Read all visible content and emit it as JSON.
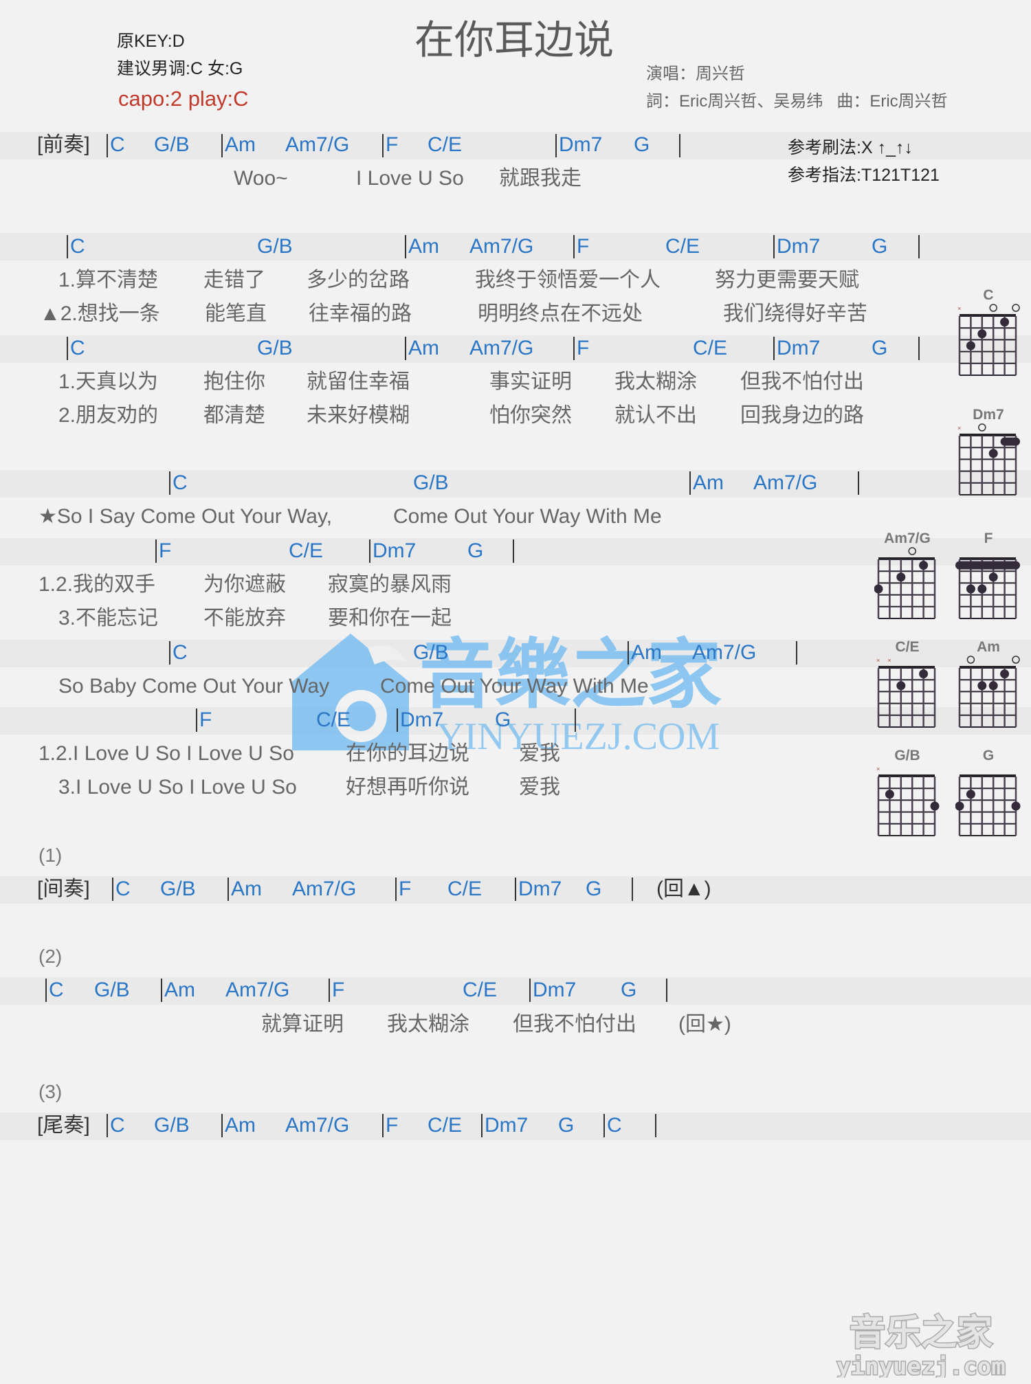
{
  "header": {
    "title": "在你耳边说",
    "original_key": "原KEY:D",
    "suggested_key": "建议男调:C 女:G",
    "capo": "capo:2 play:C",
    "singer": "演唱：周兴哲",
    "credits": "詞：Eric周兴哲、吴易纬   曲：Eric周兴哲",
    "strum": "参考刷法:X ↑_↑↓",
    "finger": "参考指法:T121T121"
  },
  "sections": {
    "prelude": {
      "label": "[前奏]",
      "chords": [
        "C",
        "G/B",
        "Am",
        "Am7/G",
        "F",
        "C/E",
        "Dm7",
        "G"
      ],
      "lyrics": [
        "Woo~",
        "I Love U So",
        "就跟我走"
      ]
    },
    "verse1": {
      "chords": [
        "C",
        "G/B",
        "Am",
        "Am7/G",
        "F",
        "C/E",
        "Dm7",
        "G"
      ],
      "line1": [
        "1.算不清楚",
        "走错了",
        "多少的岔路",
        "我终于领悟爱一个人",
        "努力更需要天赋"
      ],
      "line2": [
        "▲2.想找一条",
        "能笔直",
        "往幸福的路",
        "明明终点在不远处",
        "我们绕得好辛苦"
      ]
    },
    "verse2": {
      "chords": [
        "C",
        "G/B",
        "Am",
        "Am7/G",
        "F",
        "C/E",
        "Dm7",
        "G"
      ],
      "line1": [
        "1.天真以为",
        "抱住你",
        "就留住幸福",
        "事实证明",
        "我太糊涂",
        "但我不怕付出"
      ],
      "line2": [
        "2.朋友劝的",
        "都清楚",
        "未来好模糊",
        "怕你突然",
        "就认不出",
        "回我身边的路"
      ]
    },
    "chorus1": {
      "chords": [
        "C",
        "G/B",
        "Am",
        "Am7/G"
      ],
      "lyric": [
        "★So I Say Come Out Your Way,",
        "Come Out Your Way With Me"
      ]
    },
    "chorus2": {
      "chords": [
        "F",
        "C/E",
        "Dm7",
        "G"
      ],
      "line1": [
        "1.2.我的双手",
        "为你遮蔽",
        "寂寞的暴风雨"
      ],
      "line2": [
        "3.不能忘记",
        "不能放弃",
        "要和你在一起"
      ]
    },
    "chorus3": {
      "chords": [
        "C",
        "G/B",
        "Am",
        "Am7/G"
      ],
      "lyric": [
        "So Baby Come Out Your Way",
        "Come Out Your Way With Me"
      ]
    },
    "chorus4": {
      "chords": [
        "F",
        "C/E",
        "Dm7",
        "G"
      ],
      "line1": [
        "1.2.I Love U So I Love U So",
        "在你的耳边说",
        "爱我"
      ],
      "line2": [
        "3.I Love U So I Love U So",
        "好想再听你说",
        "爱我"
      ]
    },
    "interlude": {
      "number": "(1)",
      "label": "[间奏]",
      "chords": [
        "C",
        "G/B",
        "Am",
        "Am7/G",
        "F",
        "C/E",
        "Dm7",
        "G"
      ],
      "repeat": "(回▲)"
    },
    "bridge": {
      "number": "(2)",
      "chords": [
        "C",
        "G/B",
        "Am",
        "Am7/G",
        "F",
        "C/E",
        "Dm7",
        "G"
      ],
      "lyrics": [
        "就算证明",
        "我太糊涂",
        "但我不怕付出",
        "(回★)"
      ]
    },
    "outro": {
      "number": "(3)",
      "label": "[尾奏]",
      "chords": [
        "C",
        "G/B",
        "Am",
        "Am7/G",
        "F",
        "C/E",
        "Dm7",
        "G",
        "C"
      ]
    }
  },
  "chord_diagrams": [
    {
      "name": "C",
      "muted": [
        6
      ],
      "open": [
        3,
        1
      ],
      "dots": [
        [
          2,
          1
        ],
        [
          4,
          2
        ],
        [
          5,
          3
        ]
      ],
      "barre": null
    },
    {
      "name": "Dm7",
      "muted": [
        6
      ],
      "open": [
        4
      ],
      "dots": [
        [
          3,
          2
        ]
      ],
      "barre": {
        "fret": 1,
        "from": 2,
        "to": 1
      }
    },
    {
      "name": "Am7/G",
      "muted": [],
      "open": [
        3
      ],
      "dots": [
        [
          2,
          1
        ],
        [
          4,
          2
        ],
        [
          6,
          3
        ]
      ],
      "barre": null
    },
    {
      "name": "F",
      "muted": [],
      "open": [],
      "dots": [
        [
          3,
          2
        ],
        [
          5,
          3
        ],
        [
          4,
          3
        ]
      ],
      "barre": {
        "fret": 1,
        "from": 6,
        "to": 1
      }
    },
    {
      "name": "C/E",
      "muted": [
        6,
        5
      ],
      "open": [],
      "dots": [
        [
          2,
          1
        ],
        [
          4,
          2
        ]
      ],
      "barre": null
    },
    {
      "name": "Am",
      "muted": [],
      "open": [
        5,
        1
      ],
      "dots": [
        [
          2,
          1
        ],
        [
          4,
          2
        ],
        [
          3,
          2
        ]
      ],
      "barre": null
    },
    {
      "name": "G/B",
      "muted": [
        6
      ],
      "open": [],
      "dots": [
        [
          5,
          2
        ],
        [
          1,
          3
        ]
      ],
      "barre": null
    },
    {
      "name": "G",
      "muted": [],
      "open": [],
      "dots": [
        [
          5,
          2
        ],
        [
          6,
          3
        ],
        [
          1,
          3
        ]
      ],
      "barre": null
    }
  ],
  "watermark": {
    "center_cn": "音樂之家",
    "center_en": "YINYUEZJ.COM",
    "corner_cn": "音乐之家",
    "corner_en": "yinyuezj.com"
  }
}
